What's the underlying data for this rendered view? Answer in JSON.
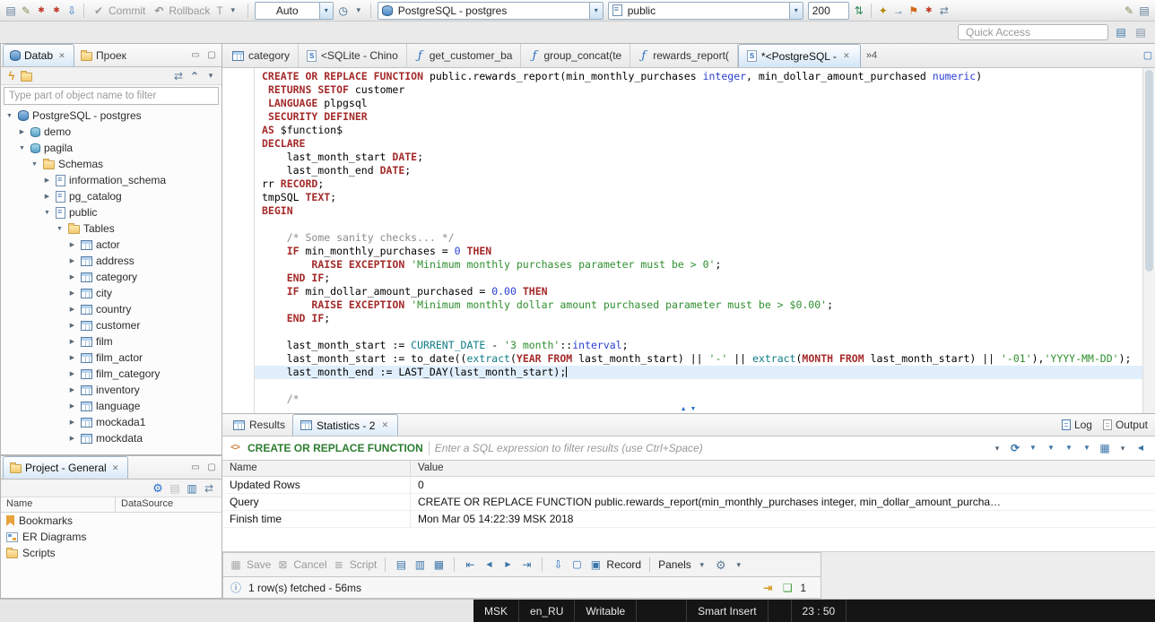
{
  "topbar": {
    "commit": "Commit",
    "rollback": "Rollback",
    "tx_mode": "T",
    "auto": "Auto",
    "connection": "PostgreSQL - postgres",
    "schema": "public",
    "row_limit": "200",
    "quick_access": "Quick Access"
  },
  "sidebar": {
    "db_tab": "Datab",
    "projects_tab": "Проек",
    "filter_placeholder": "Type part of object name to filter",
    "tree": [
      {
        "level": 0,
        "exp": "open",
        "icon": "db",
        "label": "PostgreSQL - postgres"
      },
      {
        "level": 1,
        "exp": "closed",
        "icon": "dbsm",
        "label": "demo"
      },
      {
        "level": 1,
        "exp": "open",
        "icon": "dbsm",
        "label": "pagila"
      },
      {
        "level": 2,
        "exp": "open",
        "icon": "folder",
        "label": "Schemas"
      },
      {
        "level": 3,
        "exp": "closed",
        "icon": "schema",
        "label": "information_schema"
      },
      {
        "level": 3,
        "exp": "closed",
        "icon": "schema",
        "label": "pg_catalog"
      },
      {
        "level": 3,
        "exp": "open",
        "icon": "schema",
        "label": "public"
      },
      {
        "level": 4,
        "exp": "open",
        "icon": "folder",
        "label": "Tables"
      },
      {
        "level": 5,
        "exp": "closed",
        "icon": "table",
        "label": "actor"
      },
      {
        "level": 5,
        "exp": "closed",
        "icon": "table",
        "label": "address"
      },
      {
        "level": 5,
        "exp": "closed",
        "icon": "table",
        "label": "category"
      },
      {
        "level": 5,
        "exp": "closed",
        "icon": "table",
        "label": "city"
      },
      {
        "level": 5,
        "exp": "closed",
        "icon": "table",
        "label": "country"
      },
      {
        "level": 5,
        "exp": "closed",
        "icon": "table",
        "label": "customer"
      },
      {
        "level": 5,
        "exp": "closed",
        "icon": "table",
        "label": "film"
      },
      {
        "level": 5,
        "exp": "closed",
        "icon": "table",
        "label": "film_actor"
      },
      {
        "level": 5,
        "exp": "closed",
        "icon": "table",
        "label": "film_category"
      },
      {
        "level": 5,
        "exp": "closed",
        "icon": "table",
        "label": "inventory"
      },
      {
        "level": 5,
        "exp": "closed",
        "icon": "table",
        "label": "language"
      },
      {
        "level": 5,
        "exp": "closed",
        "icon": "table",
        "label": "mockada1"
      },
      {
        "level": 5,
        "exp": "closed",
        "icon": "table",
        "label": "mockdata"
      }
    ]
  },
  "project_panel": {
    "tab": "Project - General",
    "col_name": "Name",
    "col_datasource": "DataSource",
    "items": [
      {
        "icon": "bookmark",
        "label": "Bookmarks"
      },
      {
        "icon": "diagram",
        "label": "ER Diagrams"
      },
      {
        "icon": "folder",
        "label": "Scripts"
      }
    ]
  },
  "editor": {
    "tabs": [
      {
        "icon": "table",
        "label": "category",
        "active": false
      },
      {
        "icon": "esql",
        "label": "<SQLite - Chino",
        "active": false
      },
      {
        "icon": "efn",
        "label": "get_customer_ba",
        "active": false
      },
      {
        "icon": "efn",
        "label": "group_concat(te",
        "active": false
      },
      {
        "icon": "efn",
        "label": "rewards_report(",
        "active": false
      },
      {
        "icon": "esql",
        "label": "*<PostgreSQL - ",
        "active": true
      }
    ],
    "overflow": "»4",
    "code": [
      {
        "toks": [
          [
            "k",
            "CREATE OR REPLACE FUNCTION"
          ],
          [
            "p",
            " public.rewards_report(min_monthly_purchases "
          ],
          [
            "t",
            "integer"
          ],
          [
            "p",
            ", min_dollar_amount_purchased "
          ],
          [
            "t",
            "numeric"
          ],
          [
            "p",
            ")"
          ]
        ]
      },
      {
        "toks": [
          [
            "p",
            " "
          ],
          [
            "k",
            "RETURNS SETOF"
          ],
          [
            "p",
            " customer"
          ]
        ]
      },
      {
        "toks": [
          [
            "p",
            " "
          ],
          [
            "k",
            "LANGUAGE"
          ],
          [
            "p",
            " plpgsql"
          ]
        ]
      },
      {
        "toks": [
          [
            "p",
            " "
          ],
          [
            "k",
            "SECURITY DEFINER"
          ]
        ]
      },
      {
        "toks": [
          [
            "k",
            "AS"
          ],
          [
            "p",
            " $function$"
          ]
        ]
      },
      {
        "toks": [
          [
            "k",
            "DECLARE"
          ]
        ]
      },
      {
        "toks": [
          [
            "p",
            "    last_month_start "
          ],
          [
            "k",
            "DATE"
          ],
          [
            "p",
            ";"
          ]
        ]
      },
      {
        "toks": [
          [
            "p",
            "    last_month_end "
          ],
          [
            "k",
            "DATE"
          ],
          [
            "p",
            ";"
          ]
        ]
      },
      {
        "toks": [
          [
            "p",
            "rr "
          ],
          [
            "k",
            "RECORD"
          ],
          [
            "p",
            ";"
          ]
        ]
      },
      {
        "toks": [
          [
            "p",
            "tmpSQL "
          ],
          [
            "k",
            "TEXT"
          ],
          [
            "p",
            ";"
          ]
        ]
      },
      {
        "toks": [
          [
            "k",
            "BEGIN"
          ]
        ]
      },
      {
        "toks": []
      },
      {
        "toks": [
          [
            "p",
            "    "
          ],
          [
            "c",
            "/* Some sanity checks... */"
          ]
        ]
      },
      {
        "toks": [
          [
            "p",
            "    "
          ],
          [
            "k",
            "IF"
          ],
          [
            "p",
            " min_monthly_purchases = "
          ],
          [
            "n",
            "0"
          ],
          [
            "p",
            " "
          ],
          [
            "k",
            "THEN"
          ]
        ]
      },
      {
        "toks": [
          [
            "p",
            "        "
          ],
          [
            "k",
            "RAISE EXCEPTION"
          ],
          [
            "p",
            " "
          ],
          [
            "s",
            "'Minimum monthly purchases parameter must be > 0'"
          ],
          [
            "p",
            ";"
          ]
        ]
      },
      {
        "toks": [
          [
            "p",
            "    "
          ],
          [
            "k",
            "END IF"
          ],
          [
            "p",
            ";"
          ]
        ]
      },
      {
        "toks": [
          [
            "p",
            "    "
          ],
          [
            "k",
            "IF"
          ],
          [
            "p",
            " min_dollar_amount_purchased = "
          ],
          [
            "n",
            "0.00"
          ],
          [
            "p",
            " "
          ],
          [
            "k",
            "THEN"
          ]
        ]
      },
      {
        "toks": [
          [
            "p",
            "        "
          ],
          [
            "k",
            "RAISE EXCEPTION"
          ],
          [
            "p",
            " "
          ],
          [
            "s",
            "'Minimum monthly dollar amount purchased parameter must be > $0.00'"
          ],
          [
            "p",
            ";"
          ]
        ]
      },
      {
        "toks": [
          [
            "p",
            "    "
          ],
          [
            "k",
            "END IF"
          ],
          [
            "p",
            ";"
          ]
        ]
      },
      {
        "toks": []
      },
      {
        "toks": [
          [
            "p",
            "    last_month_start := "
          ],
          [
            "f",
            "CURRENT_DATE"
          ],
          [
            "p",
            " - "
          ],
          [
            "s",
            "'3 month'"
          ],
          [
            "p",
            "::"
          ],
          [
            "t",
            "interval"
          ],
          [
            "p",
            ";"
          ]
        ]
      },
      {
        "toks": [
          [
            "p",
            "    last_month_start := to_date(("
          ],
          [
            "f",
            "extract"
          ],
          [
            "p",
            "("
          ],
          [
            "k",
            "YEAR FROM"
          ],
          [
            "p",
            " last_month_start) || "
          ],
          [
            "s",
            "'-'"
          ],
          [
            "p",
            " || "
          ],
          [
            "f",
            "extract"
          ],
          [
            "p",
            "("
          ],
          [
            "k",
            "MONTH FROM"
          ],
          [
            "p",
            " last_month_start) || "
          ],
          [
            "s",
            "'-01'"
          ],
          [
            "p",
            "),"
          ],
          [
            "s",
            "'YYYY-MM-DD'"
          ],
          [
            "p",
            ");"
          ]
        ]
      },
      {
        "hl": true,
        "caret": true,
        "toks": [
          [
            "p",
            "    last_month_end := LAST_DAY(last_month_start);"
          ]
        ]
      },
      {
        "toks": []
      },
      {
        "toks": [
          [
            "p",
            "    "
          ],
          [
            "c",
            "/*"
          ]
        ]
      }
    ]
  },
  "results": {
    "tab_results": "Results",
    "tab_statistics": "Statistics - 2",
    "log": "Log",
    "output": "Output",
    "filter_prefix": "CREATE OR REPLACE FUNCTION",
    "filter_placeholder": "Enter a SQL expression to filter results (use Ctrl+Space)",
    "columns": [
      "Name",
      "Value"
    ],
    "rows": [
      [
        "Updated Rows",
        "0"
      ],
      [
        "Query",
        "CREATE OR REPLACE FUNCTION public.rewards_report(min_monthly_purchases integer, min_dollar_amount_purcha…"
      ],
      [
        "Finish time",
        "Mon Mar 05 14:22:39 MSK 2018"
      ]
    ],
    "actions": {
      "save": "Save",
      "cancel": "Cancel",
      "script": "Script",
      "record": "Record",
      "panels": "Panels"
    },
    "status": "1 row(s) fetched - 56ms",
    "comments_count": "1"
  },
  "statusbar": {
    "tz": "MSK",
    "lang": "en_RU",
    "writable": "Writable",
    "insert_mode": "Smart Insert",
    "time": "23 : 50"
  }
}
